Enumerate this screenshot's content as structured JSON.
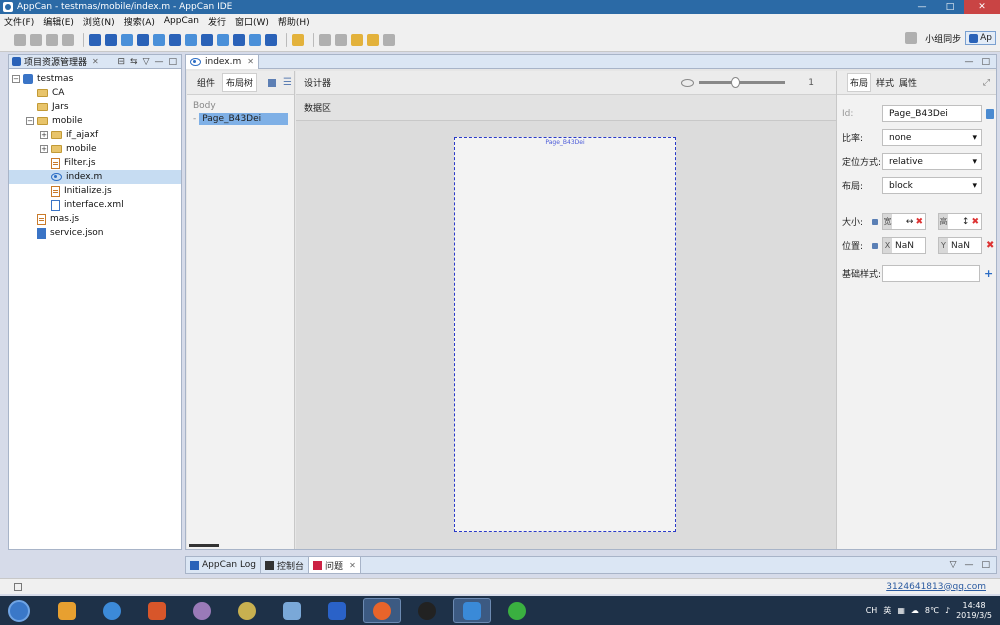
{
  "window": {
    "title": "AppCan - testmas/mobile/index.m - AppCan IDE",
    "controls": [
      "—",
      "□",
      "✕"
    ]
  },
  "menu": [
    "文件(F)",
    "编辑(E)",
    "浏览(N)",
    "搜索(A)",
    "AppCan",
    "发行",
    "窗口(W)",
    "帮助(H)"
  ],
  "toolbar": {
    "sync_label": "小组同步",
    "perspective_label": "Ap"
  },
  "explorer": {
    "tab_label": "项目资源管理器",
    "tree": [
      {
        "label": "testmas",
        "type": "project",
        "expander": "⊟",
        "indent": 0
      },
      {
        "label": "CA",
        "type": "folder",
        "expander": "",
        "indent": 1
      },
      {
        "label": "Jars",
        "type": "folder",
        "expander": "",
        "indent": 1
      },
      {
        "label": "mobile",
        "type": "folder",
        "expander": "⊟",
        "indent": 1
      },
      {
        "label": "if_ajaxf",
        "type": "folder",
        "expander": "⊞",
        "indent": 2
      },
      {
        "label": "mobile",
        "type": "folder",
        "expander": "⊞",
        "indent": 2
      },
      {
        "label": "Filter.js",
        "type": "js",
        "expander": "",
        "indent": 2
      },
      {
        "label": "index.m",
        "type": "eye",
        "expander": "",
        "indent": 2,
        "selected": true
      },
      {
        "label": "Initialize.js",
        "type": "js",
        "expander": "",
        "indent": 2
      },
      {
        "label": "interface.xml",
        "type": "xml",
        "expander": "",
        "indent": 2
      },
      {
        "label": "mas.js",
        "type": "js",
        "expander": "",
        "indent": 1
      },
      {
        "label": "service.json",
        "type": "json",
        "expander": "",
        "indent": 1
      }
    ]
  },
  "editor": {
    "tab_label": "index.m",
    "component_tabs": {
      "components": "组件",
      "layout_tree": "布局树"
    },
    "tree": {
      "body_label": "Body",
      "page_node": "Page_B43Dei"
    },
    "designer_label": "设计器",
    "data_area_label": "数据区",
    "zoom_value": "1",
    "zoom_fraction": 0.42,
    "canvas_page_name": "Page_B43Dei"
  },
  "properties": {
    "tabs": {
      "layout": "布局",
      "style": "样式",
      "attr": "属性"
    },
    "id_label": "Id:",
    "id_value": "Page_B43Dei",
    "ratio_label": "比率:",
    "ratio_value": "none",
    "position_label": "定位方式:",
    "position_value": "relative",
    "layout_label": "布局:",
    "layout_value": "block",
    "size_label": "大小:",
    "width_prefix": "宽",
    "width_arrow": "↔",
    "height_prefix": "高",
    "height_arrow": "↕",
    "pos_label": "位置:",
    "x_prefix": "X",
    "x_value": "NaN",
    "y_prefix": "Y",
    "y_value": "NaN",
    "base_style_label": "基础样式:",
    "base_style_value": ""
  },
  "console_tabs": [
    "AppCan Log",
    "控制台",
    "问题"
  ],
  "status": {
    "email": "3124641813@qq.com"
  },
  "taskbar": {
    "tray_text": "CH",
    "temperature": "8℃",
    "time": "14:48",
    "date": "2019/3/5"
  }
}
